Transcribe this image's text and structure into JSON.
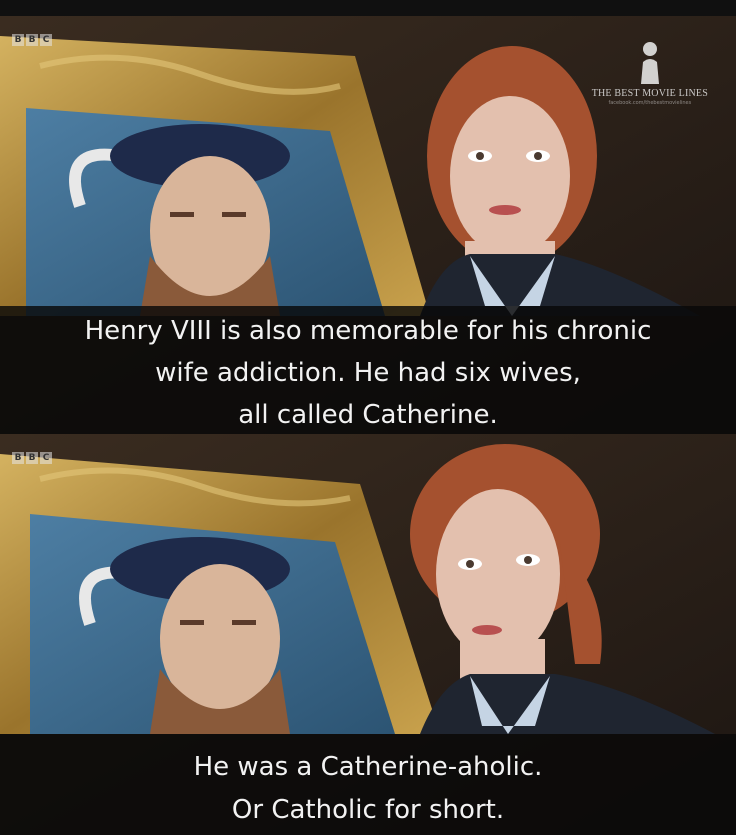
{
  "panels": [
    {
      "logo": [
        "B",
        "B",
        "C"
      ],
      "subtitle_lines": [
        "Henry VIII is also memorable for his chronic",
        "wife addiction. He had six wives,",
        "all called Catherine."
      ],
      "watermark": {
        "title": "THE BEST MOVIE LINES",
        "sub": "facebook.com/thebestmovielines"
      }
    },
    {
      "logo": [
        "B",
        "B",
        "C"
      ],
      "subtitle_lines": [
        "He was a Catherine-aholic.",
        "Or Catholic for short."
      ]
    }
  ],
  "colors": {
    "background": "#2a2018",
    "frame_gold": "#b08a3c",
    "portrait_blue": "#3e6b8c",
    "subtitle_bar": "#080808",
    "subtitle_text": "#f2f2f2"
  }
}
